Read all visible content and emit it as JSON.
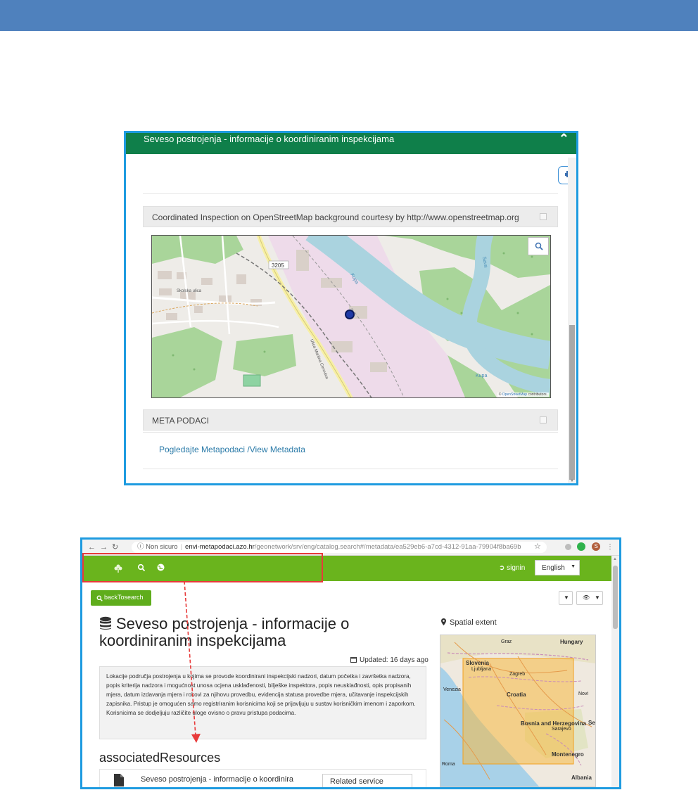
{
  "colors": {
    "header_band": "#4f81bd",
    "frame": "#1e9be0",
    "modal_header": "#0f7f4a",
    "geonetwork_bar": "#6ab41d",
    "annotation": "#e83a3a"
  },
  "screenshot_map_popup": {
    "title": "Seveso postrojenja - informacije o koordiniranim inspekcijama",
    "close_icon": "close-icon",
    "print_icon": "print-icon",
    "map_panel": {
      "heading": "Coordinated Inspection on OpenStreetMap background courtesy by http://www.openstreetmap.org",
      "map_labels": {
        "road_number": "3205",
        "street_1": "Skolska ulica",
        "street_2": "Ulica Martina Cerovica",
        "river_1": "Kupa",
        "river_2": "Kupa",
        "river_3": "Sava"
      },
      "attribution_prefix": "©",
      "attribution_link": "OpenStreetMap",
      "attribution_suffix": "contributors."
    },
    "meta_panel": {
      "heading": "META PODACI",
      "link": "Pogledajte Metapodaci /View Metadata"
    }
  },
  "screenshot_catalog": {
    "browser": {
      "security_label": "Non sicuro",
      "url_host": "envi-metapodaci.azo.hr",
      "url_path": "/geonetwork/srv/eng/catalog.search#/metadata/ea529eb6-a7cd-4312-91aa-79904f8ba69b",
      "avatar_letter": "S"
    },
    "topbar": {
      "signin": "signin",
      "language": "English"
    },
    "back_button": "backTosearch",
    "record": {
      "title": "Seveso postrojenja - informacije o koordiniranim inspekcijama",
      "updated": "Updated: 16 days ago",
      "abstract": "Lokacije područja postrojenja u kojima se provode koordinirani inspekcijski nadzori, datum početka i završetka nadzora, popis kriterija nadzora i mogućnost unosa ocjena usklađenosti, bilješke inspektora, popis neusklađnosti, opis propisanih mjera, datum izdavanja mjera i rokovi za njihovu provedbu, evidencija statusa provedbe mjera, učitavanje inspekcijskih zapisnika. Pristup je omogućen samo registriranim korisnicima koji se prijavljuju u sustav korisničkim imenom i zaporkom. Korisnicima se dodjeljuju različite uloge ovisno o pravu pristupa podacima.",
      "associated_heading": "associatedResources",
      "associated_item": "Seveso postrojenja - informacije o koordinira",
      "associated_type": "Related service"
    },
    "spatial": {
      "label": "Spatial extent",
      "places": [
        "Graz",
        "Hungary",
        "Slovenia",
        "Ljubljana",
        "Zagreb",
        "Venezia",
        "Croatia",
        "Bosnia and Herzegovina",
        "Sarajevo",
        "Montenegro",
        "Roma",
        "Albania",
        "Novi",
        "Se"
      ]
    }
  }
}
